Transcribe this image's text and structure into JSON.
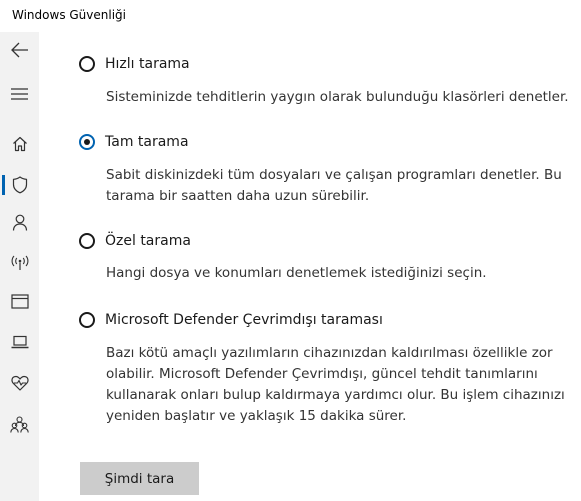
{
  "window": {
    "title": "Windows Güvenliği"
  },
  "sidebar": {
    "items": [
      {
        "icon": "back-arrow-icon"
      },
      {
        "icon": "hamburger-menu-icon"
      },
      {
        "icon": "home-icon"
      },
      {
        "icon": "shield-icon",
        "selected": true
      },
      {
        "icon": "person-icon"
      },
      {
        "icon": "wireless-antenna-icon"
      },
      {
        "icon": "browser-window-icon"
      },
      {
        "icon": "laptop-icon"
      },
      {
        "icon": "heart-pulse-icon"
      },
      {
        "icon": "family-icon"
      }
    ]
  },
  "scan_options": [
    {
      "label": "Hızlı tarama",
      "description": "Sisteminizde tehditlerin yaygın olarak bulunduğu klasörleri denetler.",
      "selected": false
    },
    {
      "label": "Tam tarama",
      "description": "Sabit diskinizdeki tüm dosyaları ve çalışan programları denetler. Bu tarama bir saatten daha uzun sürebilir.",
      "selected": true
    },
    {
      "label": "Özel tarama",
      "description": "Hangi dosya ve konumları denetlemek istediğinizi seçin.",
      "selected": false
    },
    {
      "label": "Microsoft Defender Çevrimdışı taraması",
      "description": "Bazı kötü amaçlı yazılımların cihazınızdan kaldırılması özellikle zor olabilir. Microsoft Defender Çevrimdışı, güncel tehdit tanımlarını kullanarak onları bulup kaldırmaya yardımcı olur. Bu işlem cihazınızı yeniden başlatır ve yaklaşık 15 dakika sürer.",
      "selected": false
    }
  ],
  "actions": {
    "scan_now_label": "Şimdi tara"
  },
  "colors": {
    "accent": "#0063b1",
    "sidebar_bg": "#f2f2f2",
    "button_bg": "#cccccc"
  }
}
